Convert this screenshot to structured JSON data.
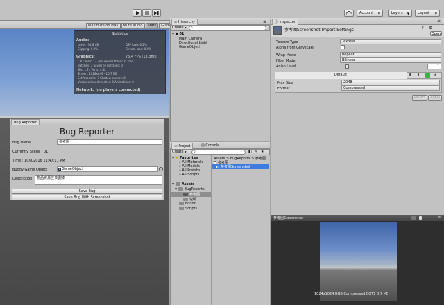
{
  "toolbar": {
    "cloud_icon": "cloud-icon",
    "account": "Account",
    "layers": "Layers",
    "layout": "Layout",
    "play_icon": "play-icon",
    "pause_icon": "pause-icon",
    "step_icon": "step-icon"
  },
  "game": {
    "buttons": [
      "Maximize on Play",
      "Mute audio",
      "Stats",
      "Gizmos"
    ],
    "stats": {
      "title": "Statistics",
      "audio_header": "Audio:",
      "audio": [
        "Level: -74.8 dB",
        "DSP load: 0.2%",
        "Clipping: 0.0%",
        "Stream load: 0.0%"
      ],
      "graphics_header": "Graphics:",
      "fps": "75.4 FPS (13.3ms)",
      "graphics": [
        "CPU: main 13.3ms  render thread 0.1ms",
        "Batches: 3        Saved by batching: 0",
        "Tris: 1.7k        Verts: 4.4k",
        "Screen: 1028x649 - 10.7 MB",
        "SetPass calls: 3  Shadow casters: 0",
        "Visible skinned meshes: 0  Animations: 0"
      ],
      "network": "Network: (no players connected)"
    }
  },
  "bug_reporter": {
    "tab": "Bug Reporter",
    "title": "Bug Reporter",
    "bug_name_label": "Bug Name",
    "bug_name_value": "参考图",
    "scene_text": "Currently Scene : 01",
    "time_text": "Time : 10/8/2016 11:47:11 PM",
    "buggy_label": "Buggy Game Object",
    "buggy_value": "GameObject",
    "desc_label": "Description",
    "desc_value": "物品资源应该删掉",
    "save_bug": "Save Bug",
    "save_bug_shot": "Save Bug With Screenshot"
  },
  "hierarchy": {
    "tab": "Hierarchy",
    "create": "Create",
    "search_placeholder": "All",
    "scene": "01",
    "items": [
      "Main Camera",
      "Directional Light",
      "GameObject"
    ]
  },
  "project": {
    "tabs": [
      "Project",
      "Console"
    ],
    "create": "Create",
    "favorites": "Favorites",
    "fav_items": [
      "All Materials",
      "All Models",
      "All Prefabs",
      "All Scripts"
    ],
    "assets": "Assets",
    "tree": [
      "BugReports",
      "参考图",
      "说明",
      "Editor",
      "Scripts"
    ],
    "breadcrumb": "Assets > BugReports > 参考图",
    "files": [
      "参考图",
      "参考图Screenshot"
    ]
  },
  "inspector": {
    "tab": "Inspector",
    "title": "参考图Screenshot Import Settings",
    "open": "Open",
    "props": [
      {
        "label": "Texture Type",
        "value": "Texture"
      },
      {
        "label": "Alpha from Grayscale",
        "value": ""
      },
      {
        "label": "Wrap Mode",
        "value": "Repeat"
      },
      {
        "label": "Filter Mode",
        "value": "Bilinear"
      },
      {
        "label": "Aniso Level",
        "value": "1"
      }
    ],
    "platform_default": "Default",
    "max_size_label": "Max Size",
    "max_size": "2048",
    "format_label": "Format",
    "format": "Compressed",
    "revert": "Revert",
    "apply": "Apply"
  },
  "preview": {
    "title": "参考图Screenshot",
    "info": "1024x1024  RGB Compressed DXT1  0.7 MB"
  }
}
